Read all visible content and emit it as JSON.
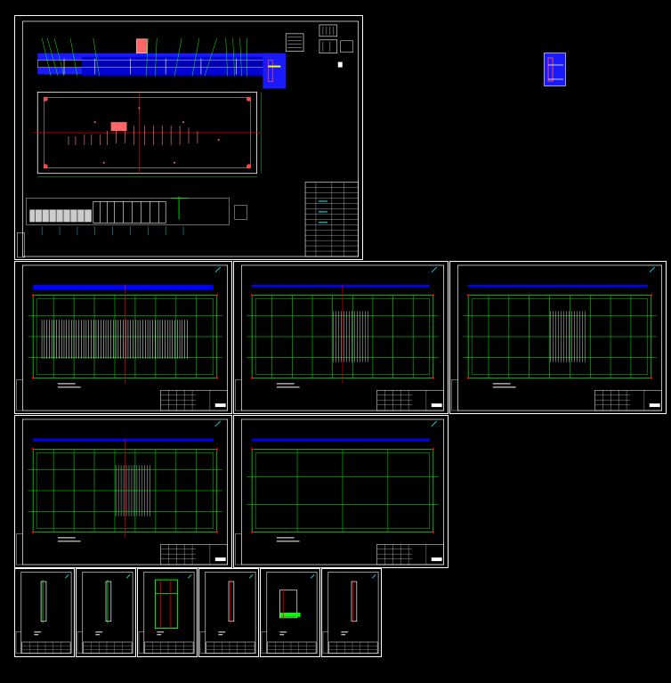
{
  "viewer": {
    "background": "#000000",
    "colors": {
      "frame": "#ffffff",
      "outline": "#00ff00",
      "axis": "#ff0000",
      "beam": "#0000ff",
      "dim": "#00ffff",
      "accent": "#ffff00"
    }
  },
  "sheets": [
    {
      "id": "main-assembly",
      "kind": "assembly"
    },
    {
      "id": "plan-1",
      "kind": "plan"
    },
    {
      "id": "plan-2",
      "kind": "plan"
    },
    {
      "id": "plan-3",
      "kind": "plan"
    },
    {
      "id": "plan-4",
      "kind": "plan"
    },
    {
      "id": "plan-5",
      "kind": "plan"
    },
    {
      "id": "detail-1",
      "kind": "detail"
    },
    {
      "id": "detail-2",
      "kind": "detail"
    },
    {
      "id": "detail-3",
      "kind": "detail"
    },
    {
      "id": "detail-4",
      "kind": "detail"
    },
    {
      "id": "detail-5",
      "kind": "detail"
    },
    {
      "id": "detail-6",
      "kind": "detail"
    },
    {
      "id": "small-section",
      "kind": "section"
    }
  ]
}
